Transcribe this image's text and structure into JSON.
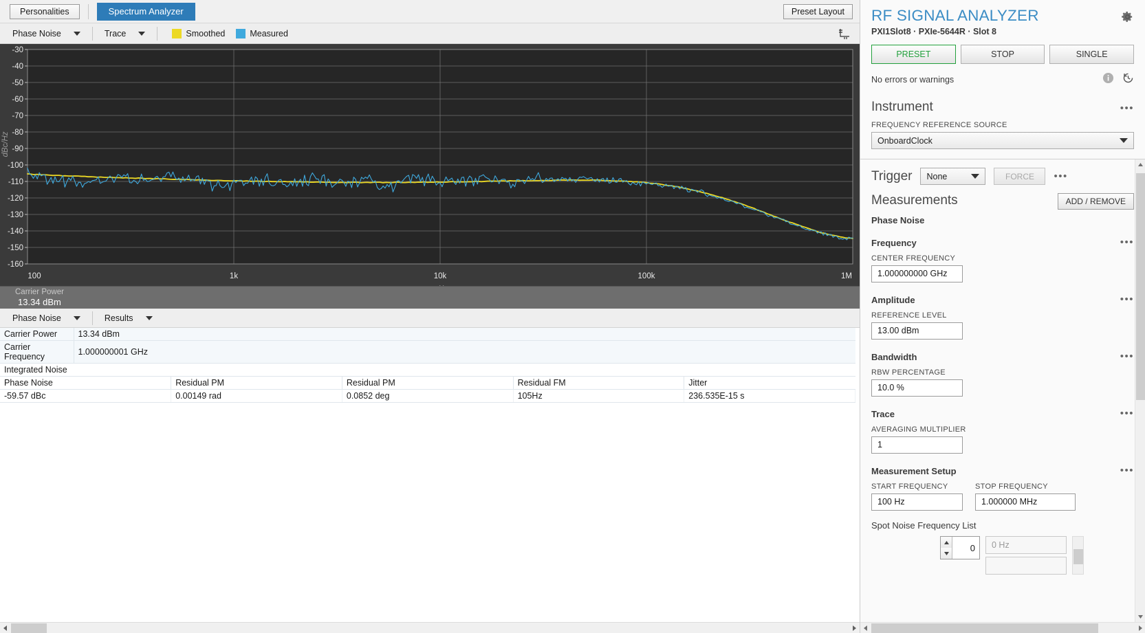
{
  "top_bar": {
    "personalities_label": "Personalities",
    "active_tab": "Spectrum Analyzer",
    "preset_layout_label": "Preset Layout"
  },
  "graph_toolbar": {
    "measurement_dropdown": "Phase Noise",
    "trace_dropdown": "Trace",
    "legend": [
      {
        "label": "Smoothed",
        "color": "#ecd925"
      },
      {
        "label": "Measured",
        "color": "#3fa9dd"
      }
    ]
  },
  "carrier_strip": {
    "label": "Carrier Power",
    "value": "13.34 dBm"
  },
  "results_toolbar": {
    "measurement_dropdown": "Phase Noise",
    "view_dropdown": "Results"
  },
  "results": {
    "key_values": [
      {
        "key": "Carrier Power",
        "value": "13.34 dBm"
      },
      {
        "key": "Carrier Frequency",
        "value": "1.000000001 GHz"
      }
    ],
    "integrated_noise_title": "Integrated Noise",
    "integrated_noise_headers": [
      "Phase Noise",
      "Residual PM",
      "Residual PM",
      "Residual FM",
      "Jitter"
    ],
    "integrated_noise_row": [
      "-59.57 dBc",
      "0.00149 rad",
      "0.0852 deg",
      "105Hz",
      "236.535E-15 s"
    ]
  },
  "right_panel": {
    "title": "RF SIGNAL ANALYZER",
    "subtitle": "PXI1Slot8  ·  PXIe-5644R  ·  Slot 8",
    "buttons": {
      "preset": "PRESET",
      "stop": "STOP",
      "single": "SINGLE"
    },
    "status": "No errors or warnings",
    "instrument": {
      "title": "Instrument",
      "freq_ref_label": "FREQUENCY REFERENCE SOURCE",
      "freq_ref_value": "OnboardClock"
    },
    "trigger": {
      "title": "Trigger",
      "value": "None",
      "force_label": "FORCE"
    },
    "measurements": {
      "title": "Measurements",
      "add_remove_label": "ADD / REMOVE",
      "active_measurement": "Phase Noise"
    },
    "frequency": {
      "title": "Frequency",
      "center_label": "CENTER FREQUENCY",
      "center_value": "1.000000000 GHz"
    },
    "amplitude": {
      "title": "Amplitude",
      "ref_level_label": "REFERENCE LEVEL",
      "ref_level_value": "13.00 dBm"
    },
    "bandwidth": {
      "title": "Bandwidth",
      "rbw_label": "RBW PERCENTAGE",
      "rbw_value": "10.0 %"
    },
    "trace": {
      "title": "Trace",
      "avg_label": "AVERAGING MULTIPLIER",
      "avg_value": "1"
    },
    "measurement_setup": {
      "title": "Measurement Setup",
      "start_label": "START FREQUENCY",
      "start_value": "100 Hz",
      "stop_label": "STOP FREQUENCY",
      "stop_value": "1.000000 MHz",
      "spot_list_label": "Spot Noise Frequency List",
      "spot_count": "0",
      "spot_item_placeholder": "0 Hz"
    }
  },
  "chart_data": {
    "type": "line",
    "title": "",
    "xlabel": "Hz",
    "ylabel": "dBc/Hz",
    "xscale": "log",
    "xlim": [
      100,
      1000000
    ],
    "ylim": [
      -160,
      -30
    ],
    "xticks": [
      100,
      1000,
      10000,
      100000,
      1000000
    ],
    "xticklabels": [
      "100",
      "1k",
      "10k",
      "100k",
      "1M"
    ],
    "yticks": [
      -30,
      -40,
      -50,
      -60,
      -70,
      -80,
      -90,
      -100,
      -110,
      -120,
      -130,
      -140,
      -150,
      -160
    ],
    "grid": true,
    "legend_position": "top",
    "background": "#262626",
    "series": [
      {
        "name": "Smoothed",
        "color": "#ecd925",
        "x": [
          100,
          130,
          170,
          220,
          290,
          380,
          500,
          650,
          850,
          1100,
          1450,
          1900,
          2500,
          3200,
          4200,
          5500,
          7200,
          9500,
          12000,
          16000,
          21000,
          27000,
          36000,
          47000,
          61000,
          80000,
          105000,
          138000,
          180000,
          236000,
          310000,
          405000,
          530000,
          700000,
          900000,
          1000000
        ],
        "y": [
          -105.5,
          -106.2,
          -106.8,
          -107.3,
          -107.8,
          -108.2,
          -108.6,
          -109.0,
          -109.4,
          -109.7,
          -110.0,
          -110.2,
          -110.4,
          -110.5,
          -110.6,
          -110.6,
          -110.5,
          -110.4,
          -110.2,
          -110.0,
          -109.7,
          -109.5,
          -109.3,
          -109.2,
          -109.3,
          -109.8,
          -111.0,
          -113.0,
          -116.0,
          -120.0,
          -125.0,
          -130.5,
          -136.0,
          -141.0,
          -144.0,
          -144.5
        ]
      },
      {
        "name": "Measured",
        "color": "#3fa9dd",
        "x": [
          100,
          130,
          170,
          220,
          290,
          380,
          500,
          650,
          850,
          1100,
          1450,
          1900,
          2500,
          3200,
          4200,
          5500,
          7200,
          9500,
          12000,
          16000,
          21000,
          27000,
          36000,
          47000,
          61000,
          80000,
          105000,
          138000,
          180000,
          236000,
          310000,
          405000,
          530000,
          700000,
          900000,
          1000000
        ],
        "y": [
          -103.0,
          -108.5,
          -110.5,
          -109.0,
          -107.5,
          -108.8,
          -106.5,
          -109.5,
          -112.5,
          -111.0,
          -108.5,
          -112.0,
          -107.5,
          -113.5,
          -108.0,
          -114.5,
          -109.0,
          -110.5,
          -110.0,
          -109.0,
          -110.5,
          -109.0,
          -109.5,
          -108.5,
          -109.5,
          -110.0,
          -111.5,
          -113.5,
          -116.5,
          -120.5,
          -125.5,
          -131.0,
          -136.5,
          -141.5,
          -144.5,
          -144.0
        ]
      }
    ]
  }
}
